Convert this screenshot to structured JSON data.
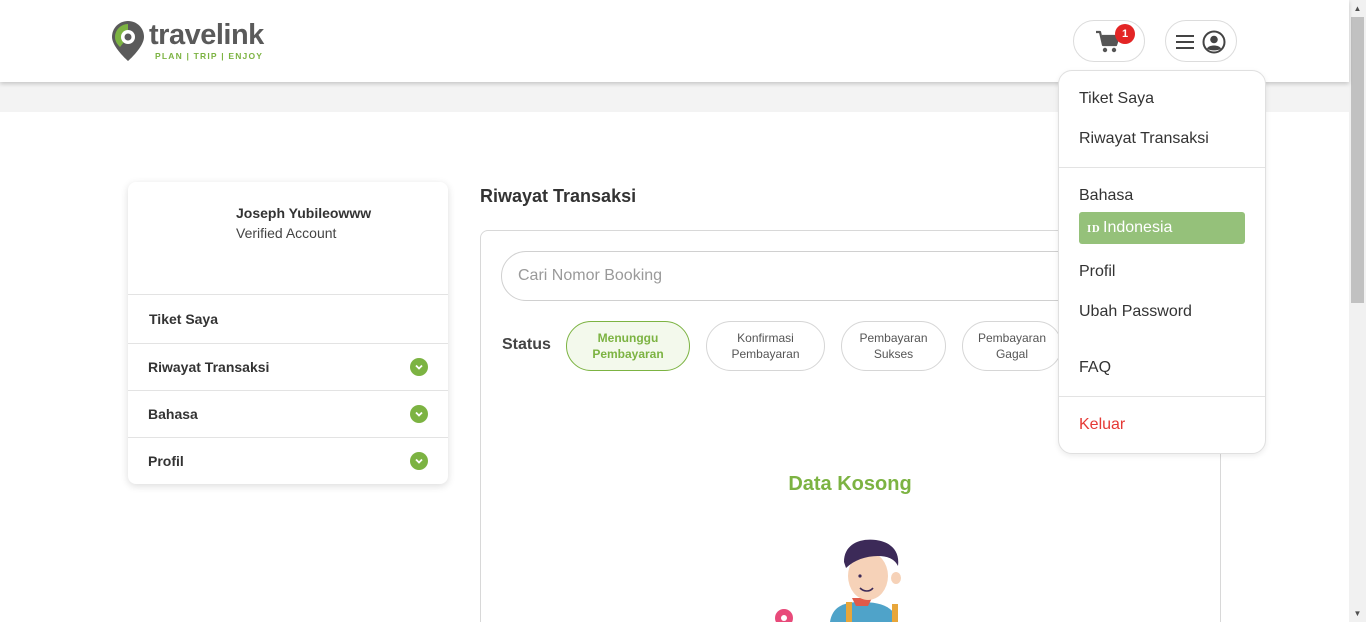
{
  "brand": {
    "name": "travelink",
    "tagline": "PLAN | TRIP | ENJOY",
    "accent": "#7cb342"
  },
  "header": {
    "cart_count": "1",
    "cart_icon": "cart-icon",
    "menu_icon": "hamburger-icon",
    "user_icon": "user-circle-icon"
  },
  "profile": {
    "name": "Joseph Yubileowww",
    "status": "Verified Account"
  },
  "sidebar": {
    "items": [
      {
        "label": "Tiket Saya"
      },
      {
        "label": "Riwayat Transaksi"
      },
      {
        "label": "Bahasa"
      },
      {
        "label": "Profil"
      }
    ]
  },
  "main": {
    "title": "Riwayat Transaksi",
    "search_placeholder": "Cari Nomor Booking",
    "status_label": "Status",
    "filters": [
      {
        "line1": "Menunggu",
        "line2": "Pembayaran",
        "active": true
      },
      {
        "line1": "Konfirmasi",
        "line2": "Pembayaran",
        "active": false
      },
      {
        "line1": "Pembayaran",
        "line2": "Sukses",
        "active": false
      },
      {
        "line1": "Pembayaran",
        "line2": "Gagal",
        "active": false
      }
    ],
    "empty_title": "Data Kosong"
  },
  "dropdown": {
    "tiket_saya": "Tiket Saya",
    "riwayat": "Riwayat Transaksi",
    "bahasa": "Bahasa",
    "lang_code": "ID",
    "lang_name": "Indonesia",
    "profil": "Profil",
    "ubah_password": "Ubah Password",
    "faq": "FAQ",
    "keluar": "Keluar"
  }
}
